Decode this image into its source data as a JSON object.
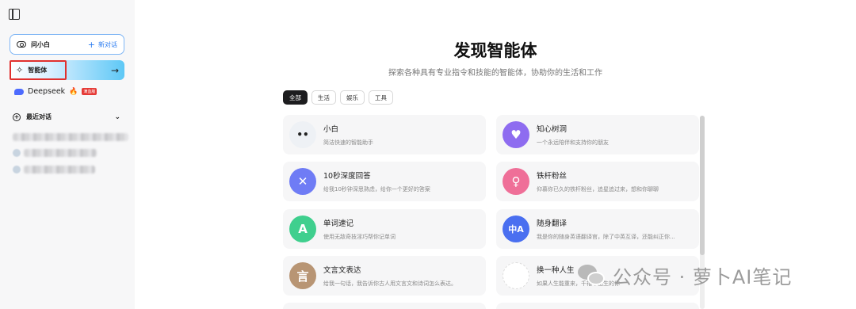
{
  "sidebar": {
    "app_name": "问小白",
    "new_chat": "新对话",
    "agents_label": "智能体",
    "deepseek_label": "Deepseek",
    "deepseek_badge": "满血版",
    "recent_label": "最近对话"
  },
  "main": {
    "title": "发现智能体",
    "subtitle": "探索各种具有专业指令和技能的智能体，协助你的生活和工作",
    "tabs": [
      {
        "label": "全部",
        "active": true
      },
      {
        "label": "生活",
        "active": false
      },
      {
        "label": "娱乐",
        "active": false
      },
      {
        "label": "工具",
        "active": false
      }
    ],
    "cards": [
      {
        "name": "小白",
        "desc": "简洁快速的智能助手",
        "icon": "xiaobai-face-icon",
        "color": "#eef1f5",
        "glyph": "••"
      },
      {
        "name": "知心树洞",
        "desc": "一个永远陪伴和支持你的朋友",
        "icon": "heart-icon",
        "color": "#8e6cf0",
        "glyph": "♥"
      },
      {
        "name": "10秒深度回答",
        "desc": "给我10秒钟深思熟虑，给你一个更好的答案",
        "icon": "cross-tools-icon",
        "color": "#6f7cf5",
        "glyph": "✕"
      },
      {
        "name": "铁杆粉丝",
        "desc": "仰慕你已久的铁杆粉丝，追星追过来，想和你聊聊",
        "icon": "fan-person-icon",
        "color": "#ef6f98",
        "glyph": "♀"
      },
      {
        "name": "单词速记",
        "desc": "使用无敌奇技淫巧帮你记单词",
        "icon": "letter-a-icon",
        "color": "#3fcf8e",
        "glyph": "A"
      },
      {
        "name": "随身翻译",
        "desc": "我是你的随身英语翻译官，除了中英互译，还能纠正你...",
        "icon": "translate-icon",
        "color": "#4a6ff0",
        "glyph": "中A"
      },
      {
        "name": "文言文表达",
        "desc": "给我一句话，我告诉你古人用文言文和诗词怎么表达。",
        "icon": "classical-word-icon",
        "color": "#b89574",
        "glyph": "言"
      },
      {
        "name": "换一种人生",
        "desc": "如果人生能重来，千禧年出生的你",
        "icon": "life-icon",
        "color": "#ffffff",
        "glyph": ""
      }
    ]
  },
  "watermark": "公众号 · 萝卜AI笔记"
}
